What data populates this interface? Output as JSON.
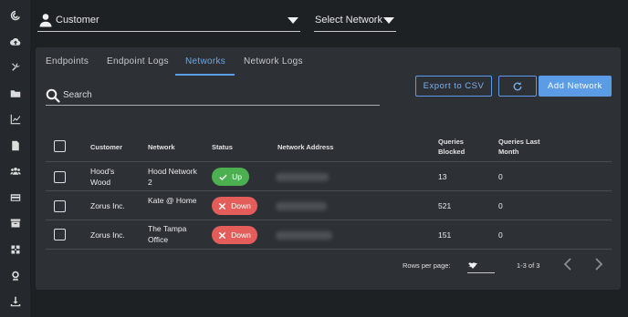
{
  "sidebar": {
    "icons": [
      "logo-icon",
      "cloud-upload-icon",
      "tools-icon",
      "folder-icon",
      "chart-icon",
      "document-icon",
      "users-icon",
      "credit-card-icon",
      "archive-icon",
      "puzzle-icon",
      "award-icon",
      "download-icon"
    ]
  },
  "filters": {
    "customer_label": "Customer",
    "network_label": "Select Network"
  },
  "tabs": [
    {
      "label": "Endpoints"
    },
    {
      "label": "Endpoint Logs"
    },
    {
      "label": "Networks"
    },
    {
      "label": "Network Logs"
    }
  ],
  "active_tab": "Networks",
  "search": {
    "placeholder": "Search"
  },
  "toolbar": {
    "export_label": "Export to CSV",
    "refresh_icon": "refresh-icon",
    "add_label": "Add Network"
  },
  "table": {
    "headers": {
      "customer": "Customer",
      "network": "Network",
      "status": "Status",
      "address": "Network Address",
      "queries_blocked": "Queries Blocked",
      "queries_last_month": "Queries Last Month"
    },
    "rows": [
      {
        "customer": "Hood's Wood",
        "network": "Hood Network 2",
        "status": "Up",
        "queries_blocked": "13",
        "queries_last_month": "0"
      },
      {
        "customer": "Zorus Inc.",
        "network": "Kate @ Home",
        "status": "Down",
        "queries_blocked": "521",
        "queries_last_month": "0"
      },
      {
        "customer": "Zorus Inc.",
        "network": "The Tampa Office",
        "status": "Down",
        "queries_blocked": "151",
        "queries_last_month": "0"
      }
    ]
  },
  "pagination": {
    "rows_per_page_label": "Rows per page:",
    "rows_per_page": "10",
    "range": "1-3 of 3"
  },
  "colors": {
    "accent": "#5c9ce6",
    "status_up": "#4caf50",
    "status_down": "#e35d5b",
    "panel": "#2d3136",
    "background": "#1e2124"
  }
}
